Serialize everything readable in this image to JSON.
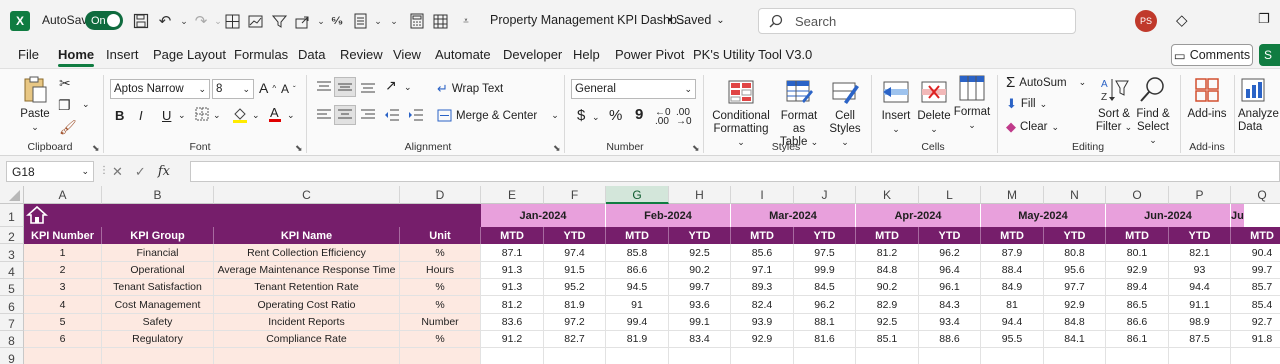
{
  "titlebar": {
    "app_icon": "X",
    "autosave_label": "AutoSave",
    "autosave_state": "On",
    "doc_title": "Property Management KPI Dashb...",
    "saved_status": "• Saved",
    "search_placeholder": "Search",
    "user_initials": "PS"
  },
  "menu": {
    "tabs": [
      "File",
      "Home",
      "Insert",
      "Page Layout",
      "Formulas",
      "Data",
      "Review",
      "View",
      "Automate",
      "Developer",
      "Help",
      "Power Pivot",
      "PK's Utility Tool V3.0"
    ],
    "active_tab": "Home",
    "comments_label": "Comments",
    "share_label": "S"
  },
  "ribbon": {
    "clipboard": {
      "paste": "Paste",
      "label": "Clipboard"
    },
    "font": {
      "name": "Aptos Narrow",
      "size": "8",
      "label": "Font",
      "bold": "B",
      "italic": "I",
      "underline": "U"
    },
    "alignment": {
      "wrap_text": "Wrap Text",
      "merge_center": "Merge & Center",
      "label": "Alignment"
    },
    "number": {
      "format": "General",
      "label": "Number",
      "currency": "$",
      "percent": "%",
      "comma": "9"
    },
    "styles": {
      "conditional_1": "Conditional",
      "conditional_2": "Formatting",
      "format_table_1": "Format as",
      "format_table_2": "Table",
      "cell_styles_1": "Cell",
      "cell_styles_2": "Styles",
      "label": "Styles"
    },
    "cells": {
      "insert": "Insert",
      "delete": "Delete",
      "format": "Format",
      "label": "Cells"
    },
    "editing": {
      "autosum": "AutoSum",
      "fill": "Fill",
      "clear": "Clear",
      "sort_1": "Sort &",
      "sort_2": "Filter",
      "find_1": "Find &",
      "find_2": "Select",
      "label": "Editing"
    },
    "addins": {
      "addins": "Add-ins",
      "label": "Add-ins",
      "analyze_1": "Analyze",
      "analyze_2": "Data"
    }
  },
  "formula_bar": {
    "name_box": "G18",
    "fx": "fx",
    "content": ""
  },
  "sheet": {
    "columns": [
      "A",
      "B",
      "C",
      "D",
      "E",
      "F",
      "G",
      "H",
      "I",
      "J",
      "K",
      "L",
      "M",
      "N",
      "O",
      "P",
      "Q"
    ],
    "selected_column": "G",
    "rows": [
      "1",
      "2",
      "3",
      "4",
      "5",
      "6",
      "7",
      "8",
      "9"
    ],
    "headers": [
      "KPI Number",
      "KPI Group",
      "KPI Name",
      "Unit"
    ],
    "months": [
      "Jan-2024",
      "Feb-2024",
      "Mar-2024",
      "Apr-2024",
      "May-2024",
      "Jun-2024",
      "Ju"
    ],
    "mtd": "MTD",
    "ytd": "YTD",
    "kpis": [
      {
        "num": "1",
        "group": "Financial",
        "name": "Rent Collection Efficiency",
        "unit": "%",
        "values": [
          "87.1",
          "97.4",
          "85.8",
          "92.5",
          "85.6",
          "97.5",
          "81.2",
          "96.2",
          "87.9",
          "80.8",
          "80.1",
          "82.1",
          "90.4"
        ]
      },
      {
        "num": "2",
        "group": "Operational",
        "name": "Average Maintenance Response Time",
        "unit": "Hours",
        "values": [
          "91.3",
          "91.5",
          "86.6",
          "90.2",
          "97.1",
          "99.9",
          "84.8",
          "96.4",
          "88.4",
          "95.6",
          "92.9",
          "93",
          "99.7"
        ]
      },
      {
        "num": "3",
        "group": "Tenant Satisfaction",
        "name": "Tenant Retention Rate",
        "unit": "%",
        "values": [
          "91.3",
          "95.2",
          "94.5",
          "99.7",
          "89.3",
          "84.5",
          "90.2",
          "96.1",
          "84.9",
          "97.7",
          "89.4",
          "94.4",
          "85.7"
        ]
      },
      {
        "num": "4",
        "group": "Cost Management",
        "name": "Operating Cost Ratio",
        "unit": "%",
        "values": [
          "81.2",
          "81.9",
          "91",
          "93.6",
          "82.4",
          "96.2",
          "82.9",
          "84.3",
          "81",
          "92.9",
          "86.5",
          "91.1",
          "85.4"
        ]
      },
      {
        "num": "5",
        "group": "Safety",
        "name": "Incident Reports",
        "unit": "Number",
        "values": [
          "83.6",
          "97.2",
          "99.4",
          "99.1",
          "93.9",
          "88.1",
          "92.5",
          "93.4",
          "94.4",
          "84.8",
          "86.6",
          "98.9",
          "92.7"
        ]
      },
      {
        "num": "6",
        "group": "Regulatory",
        "name": "Compliance Rate",
        "unit": "%",
        "values": [
          "91.2",
          "82.7",
          "81.9",
          "83.4",
          "92.9",
          "81.6",
          "85.1",
          "88.6",
          "95.5",
          "84.1",
          "86.1",
          "87.5",
          "91.8"
        ]
      }
    ]
  },
  "colors": {
    "accent": "#107c41",
    "banner": "#761e6b",
    "month_fill": "#e8a0dc",
    "info_fill": "#fde9e1"
  }
}
